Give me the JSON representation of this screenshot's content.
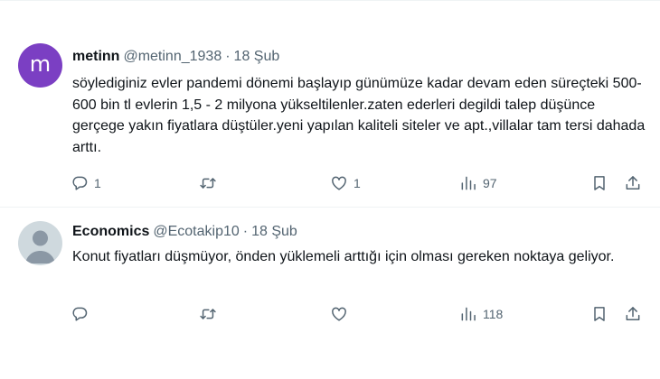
{
  "tweets": [
    {
      "avatar_letter": "m",
      "name": "metinn",
      "handle": "@metinn_1938",
      "separator": "·",
      "date": "18 Şub",
      "text": "söylediginiz evler pandemi dönemi başlayıp günümüze kadar devam eden süreçteki 500-600 bin tl evlerin 1,5 - 2 milyona yükseltilenler.zaten ederleri degildi talep düşünce gerçege yakın fiyatlara düştüler.yeni yapılan kaliteli siteler ve apt.,villalar tam tersi dahada arttı.",
      "replies": "1",
      "retweets": "",
      "likes": "1",
      "views": "97"
    },
    {
      "avatar_letter": "",
      "name": "Economics",
      "handle": "@Ecotakip10",
      "separator": "·",
      "date": "18 Şub",
      "text": "Konut fiyatları düşmüyor, önden yüklemeli arttığı için olması gereken noktaya geliyor.",
      "replies": "",
      "retweets": "",
      "likes": "",
      "views": "118"
    }
  ],
  "icons": {
    "reply": "reply-icon",
    "retweet": "retweet-icon",
    "like": "heart-icon",
    "views": "views-chart-icon",
    "bookmark": "bookmark-icon",
    "share": "share-icon"
  },
  "colors": {
    "text": "#0f1419",
    "secondary": "#536471",
    "divider": "#eff3f4",
    "avatar_metinn": "#7b3fc3",
    "avatar_default": "#cfd9de"
  }
}
